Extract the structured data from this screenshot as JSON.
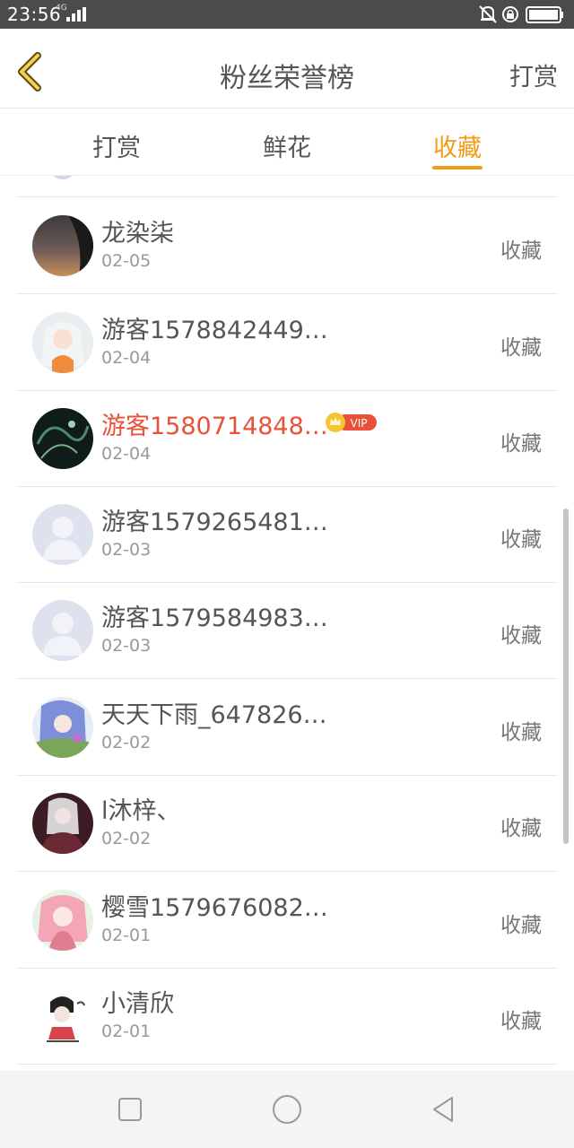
{
  "status": {
    "time": "23:56",
    "network": "4G"
  },
  "header": {
    "title": "粉丝荣誉榜",
    "action": "打赏"
  },
  "tabs": [
    {
      "label": "打赏"
    },
    {
      "label": "鲜花"
    },
    {
      "label": "收藏",
      "active": true
    }
  ],
  "colors": {
    "accent": "#f29d18",
    "vip_name": "#e8513a",
    "vip_badge": "#e8513a"
  },
  "list": [
    {
      "name": "龙染柒",
      "date": "02-05",
      "action": "收藏"
    },
    {
      "name": "游客1578842449…",
      "date": "02-04",
      "action": "收藏"
    },
    {
      "name": "游客1580714848…",
      "date": "02-04",
      "action": "收藏",
      "vip": true,
      "vip_label": "VIP"
    },
    {
      "name": "游客1579265481…",
      "date": "02-03",
      "action": "收藏"
    },
    {
      "name": "游客1579584983…",
      "date": "02-03",
      "action": "收藏"
    },
    {
      "name": "天天下雨_647826…",
      "date": "02-02",
      "action": "收藏"
    },
    {
      "name": "l沐梓、",
      "date": "02-02",
      "action": "收藏"
    },
    {
      "name": "樱雪1579676082…",
      "date": "02-01",
      "action": "收藏"
    },
    {
      "name": "小清欣",
      "date": "02-01",
      "action": "收藏"
    }
  ]
}
